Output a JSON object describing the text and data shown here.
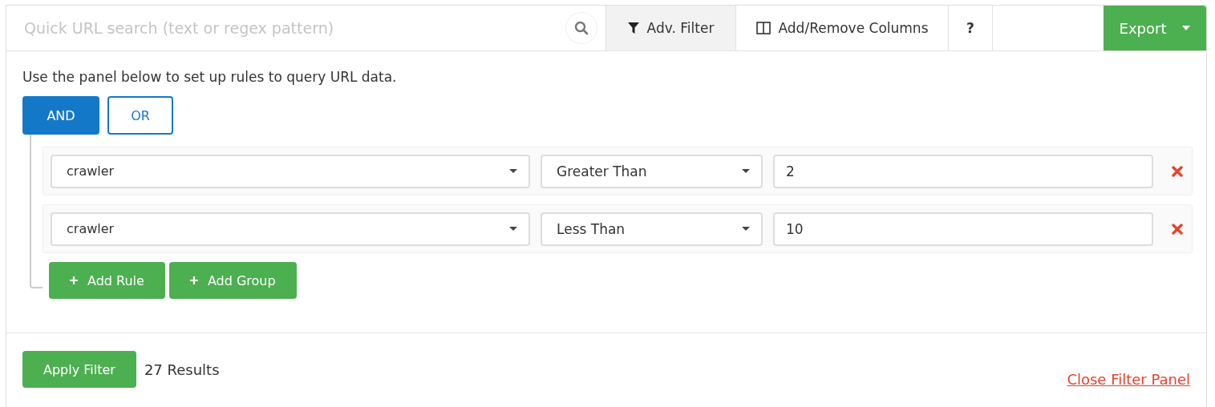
{
  "search": {
    "placeholder": "Quick URL search (text or regex pattern)"
  },
  "toolbar": [
    {
      "label": "Adv. Filter",
      "kind": "filter",
      "selected": true
    },
    {
      "label": "Add/Remove Columns",
      "kind": "columns",
      "selected": false
    },
    {
      "label": "?",
      "kind": "help",
      "selected": false
    }
  ],
  "export_button": {
    "label": "Export"
  },
  "intro": "Use the panel below to set up rules to query URL data.",
  "conjunctions": [
    {
      "label": "AND",
      "selected": true
    },
    {
      "label": "OR",
      "selected": false
    }
  ],
  "rules": [
    {
      "field": "crawler",
      "operator": "Greater Than",
      "value": "2"
    },
    {
      "field": "crawler",
      "operator": "Less Than",
      "value": "10"
    }
  ],
  "group_buttons": [
    {
      "label": "Add Rule"
    },
    {
      "label": "Add Group"
    }
  ],
  "apply_button": {
    "label": "Apply Filter"
  },
  "results": "27 Results",
  "close_link": "Close Filter Panel"
}
